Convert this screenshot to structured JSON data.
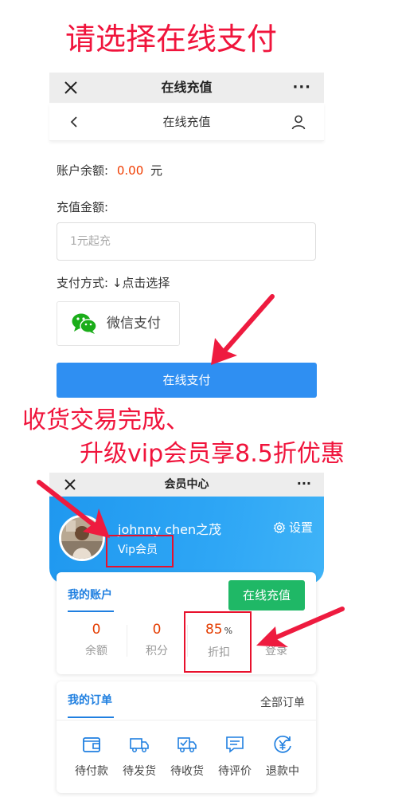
{
  "annotations": {
    "heading": "请选择在线支付",
    "note_line1": "收货交易完成、",
    "note_line2": "升级vip会员享8.5折优惠"
  },
  "recharge_page": {
    "window_title": "在线充值",
    "nav_title": "在线充值",
    "balance_label": "账户余额:",
    "balance_value": "0.00",
    "balance_unit": "元",
    "amount_label": "充值金额:",
    "amount_placeholder": "1元起充",
    "pay_method_label": "支付方式: ↓点击选择",
    "wechat_pay_label": "微信支付",
    "pay_button_label": "在线支付"
  },
  "member_page": {
    "window_title": "会员中心",
    "username": "johnny chen之茂",
    "vip_label": "Vip会员",
    "settings_label": "设置",
    "account_tab": "我的账户",
    "recharge_button": "在线充值",
    "stats": [
      {
        "value": "0",
        "label": "余额"
      },
      {
        "value": "0",
        "label": "积分"
      },
      {
        "value": "85",
        "unit": "%",
        "label": "折扣"
      },
      {
        "label": "登录"
      }
    ],
    "orders_tab": "我的订单",
    "all_orders": "全部订单",
    "order_items": [
      {
        "label": "待付款",
        "icon": "wallet-icon"
      },
      {
        "label": "待发货",
        "icon": "truck-icon"
      },
      {
        "label": "待收货",
        "icon": "delivery-check-icon"
      },
      {
        "label": "待评价",
        "icon": "comment-icon"
      },
      {
        "label": "退款中",
        "icon": "refund-yen-icon"
      }
    ]
  },
  "colors": {
    "annotation_red": "#f0143c",
    "primary_blue": "#2f8ff2",
    "recharge_green": "#1fb866",
    "value_orange": "#e43c00"
  }
}
